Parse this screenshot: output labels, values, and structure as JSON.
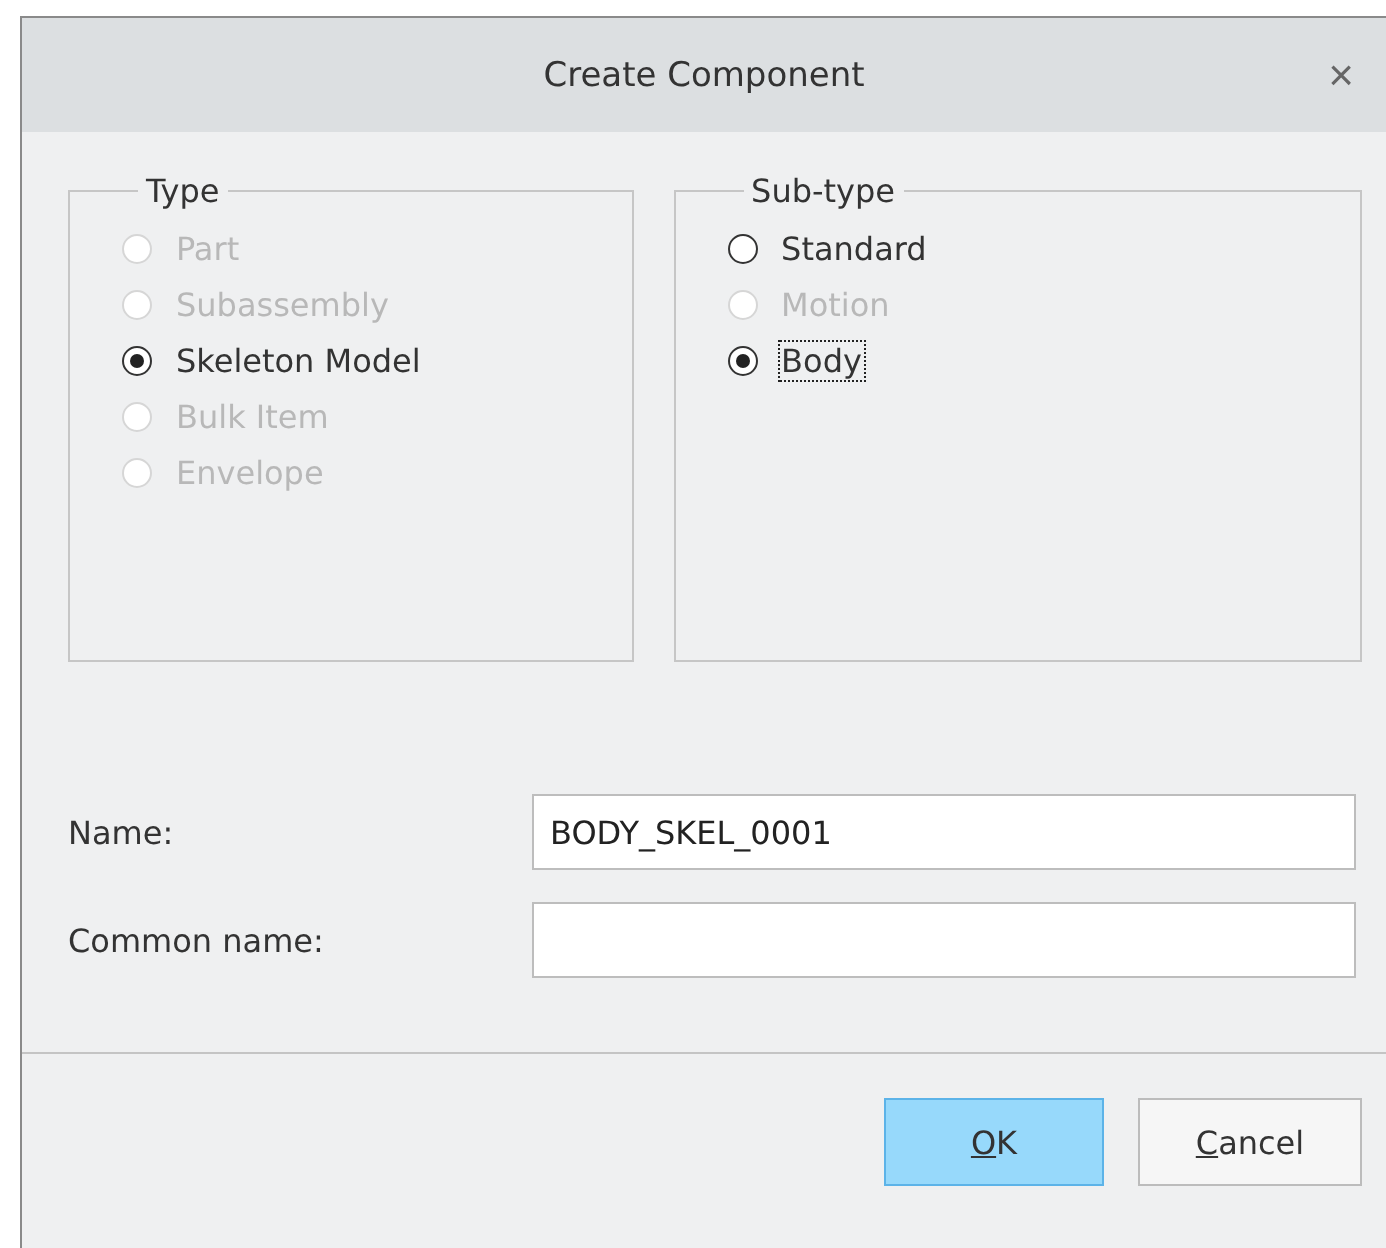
{
  "window": {
    "title": "Create Component",
    "close": "×"
  },
  "groups": [
    {
      "title": "Type",
      "options": [
        {
          "label": "Part",
          "selected": false,
          "disabled": true,
          "focused": false
        },
        {
          "label": "Subassembly",
          "selected": false,
          "disabled": true,
          "focused": false
        },
        {
          "label": "Skeleton Model",
          "selected": true,
          "disabled": false,
          "focused": false
        },
        {
          "label": "Bulk Item",
          "selected": false,
          "disabled": true,
          "focused": false
        },
        {
          "label": "Envelope",
          "selected": false,
          "disabled": true,
          "focused": false
        }
      ]
    },
    {
      "title": "Sub-type",
      "options": [
        {
          "label": "Standard",
          "selected": false,
          "disabled": false,
          "focused": false
        },
        {
          "label": "Motion",
          "selected": false,
          "disabled": true,
          "focused": false
        },
        {
          "label": "Body",
          "selected": true,
          "disabled": false,
          "focused": true
        }
      ]
    }
  ],
  "fields": [
    {
      "label": "Name:",
      "value": "BODY_SKEL_0001"
    },
    {
      "label": "Common name:"
    }
  ],
  "buttons": [
    {
      "label": "OK",
      "default": true
    },
    {
      "label": "Cancel",
      "default": false
    }
  ]
}
